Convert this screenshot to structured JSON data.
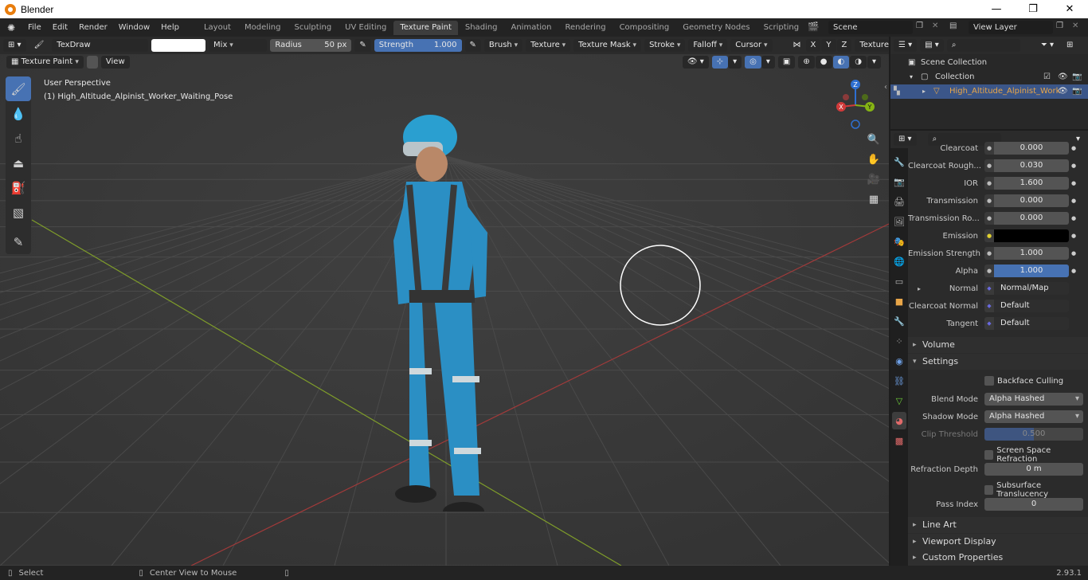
{
  "window": {
    "title": "Blender",
    "minimize": "—",
    "maximize": "❐",
    "close": "✕"
  },
  "menu": [
    "File",
    "Edit",
    "Render",
    "Window",
    "Help"
  ],
  "workspaces": [
    "Layout",
    "Modeling",
    "Sculpting",
    "UV Editing",
    "Texture Paint",
    "Shading",
    "Animation",
    "Rendering",
    "Compositing",
    "Geometry Nodes",
    "Scripting"
  ],
  "active_workspace": "Texture Paint",
  "add_workspace": "+",
  "scene": {
    "name": "Scene",
    "view_layer": "View Layer"
  },
  "tool_header": {
    "brush_name": "TexDraw",
    "blend": "Mix",
    "radius_label": "Radius",
    "radius_value": "50 px",
    "strength_label": "Strength",
    "strength_value": "1.000",
    "menus": [
      "Brush",
      "Texture",
      "Texture Mask",
      "Stroke",
      "Falloff",
      "Cursor"
    ],
    "axes": [
      "X",
      "Y",
      "Z"
    ],
    "texture_slots": "Texture Sl"
  },
  "mode": {
    "label": "Texture Paint",
    "view": "View"
  },
  "viewport": {
    "perspective": "User Perspective",
    "object_label": "(1) High_Altitude_Alpinist_Worker_Waiting_Pose"
  },
  "gizmo": {
    "x": "X",
    "y": "Y",
    "z": "Z"
  },
  "outliner": {
    "scene_collection": "Scene Collection",
    "collection": "Collection",
    "object": "High_Altitude_Alpinist_Work"
  },
  "properties": {
    "rows": [
      {
        "label": "Clearcoat",
        "value": "0.000"
      },
      {
        "label": "Clearcoat Rough...",
        "value": "0.030"
      },
      {
        "label": "IOR",
        "value": "1.600"
      },
      {
        "label": "Transmission",
        "value": "0.000"
      },
      {
        "label": "Transmission Ro...",
        "value": "0.000"
      },
      {
        "label": "Emission",
        "value": ""
      },
      {
        "label": "Emission Strength",
        "value": "1.000"
      },
      {
        "label": "Alpha",
        "value": "1.000"
      },
      {
        "label": "Normal",
        "value": "Normal/Map"
      },
      {
        "label": "Clearcoat Normal",
        "value": "Default"
      },
      {
        "label": "Tangent",
        "value": "Default"
      }
    ],
    "sections": {
      "volume": "Volume",
      "settings": "Settings",
      "line_art": "Line Art",
      "viewport_display": "Viewport Display",
      "custom_properties": "Custom Properties"
    },
    "settings": {
      "backface_culling": "Backface Culling",
      "blend_mode_label": "Blend Mode",
      "blend_mode": "Alpha Hashed",
      "shadow_mode_label": "Shadow Mode",
      "shadow_mode": "Alpha Hashed",
      "clip_threshold_label": "Clip Threshold",
      "clip_threshold": "0.500",
      "screen_space_refraction": "Screen Space Refraction",
      "refraction_depth_label": "Refraction Depth",
      "refraction_depth": "0 m",
      "subsurface_translucency": "Subsurface Translucency",
      "pass_index_label": "Pass Index",
      "pass_index": "0"
    }
  },
  "status": {
    "select": "Select",
    "center": "Center View to Mouse",
    "version": "2.93.1"
  },
  "colors": {
    "accent": "#4772b3",
    "header": "#2b2b2b",
    "viewport": "#393939",
    "selected_object": "#e9a648"
  }
}
